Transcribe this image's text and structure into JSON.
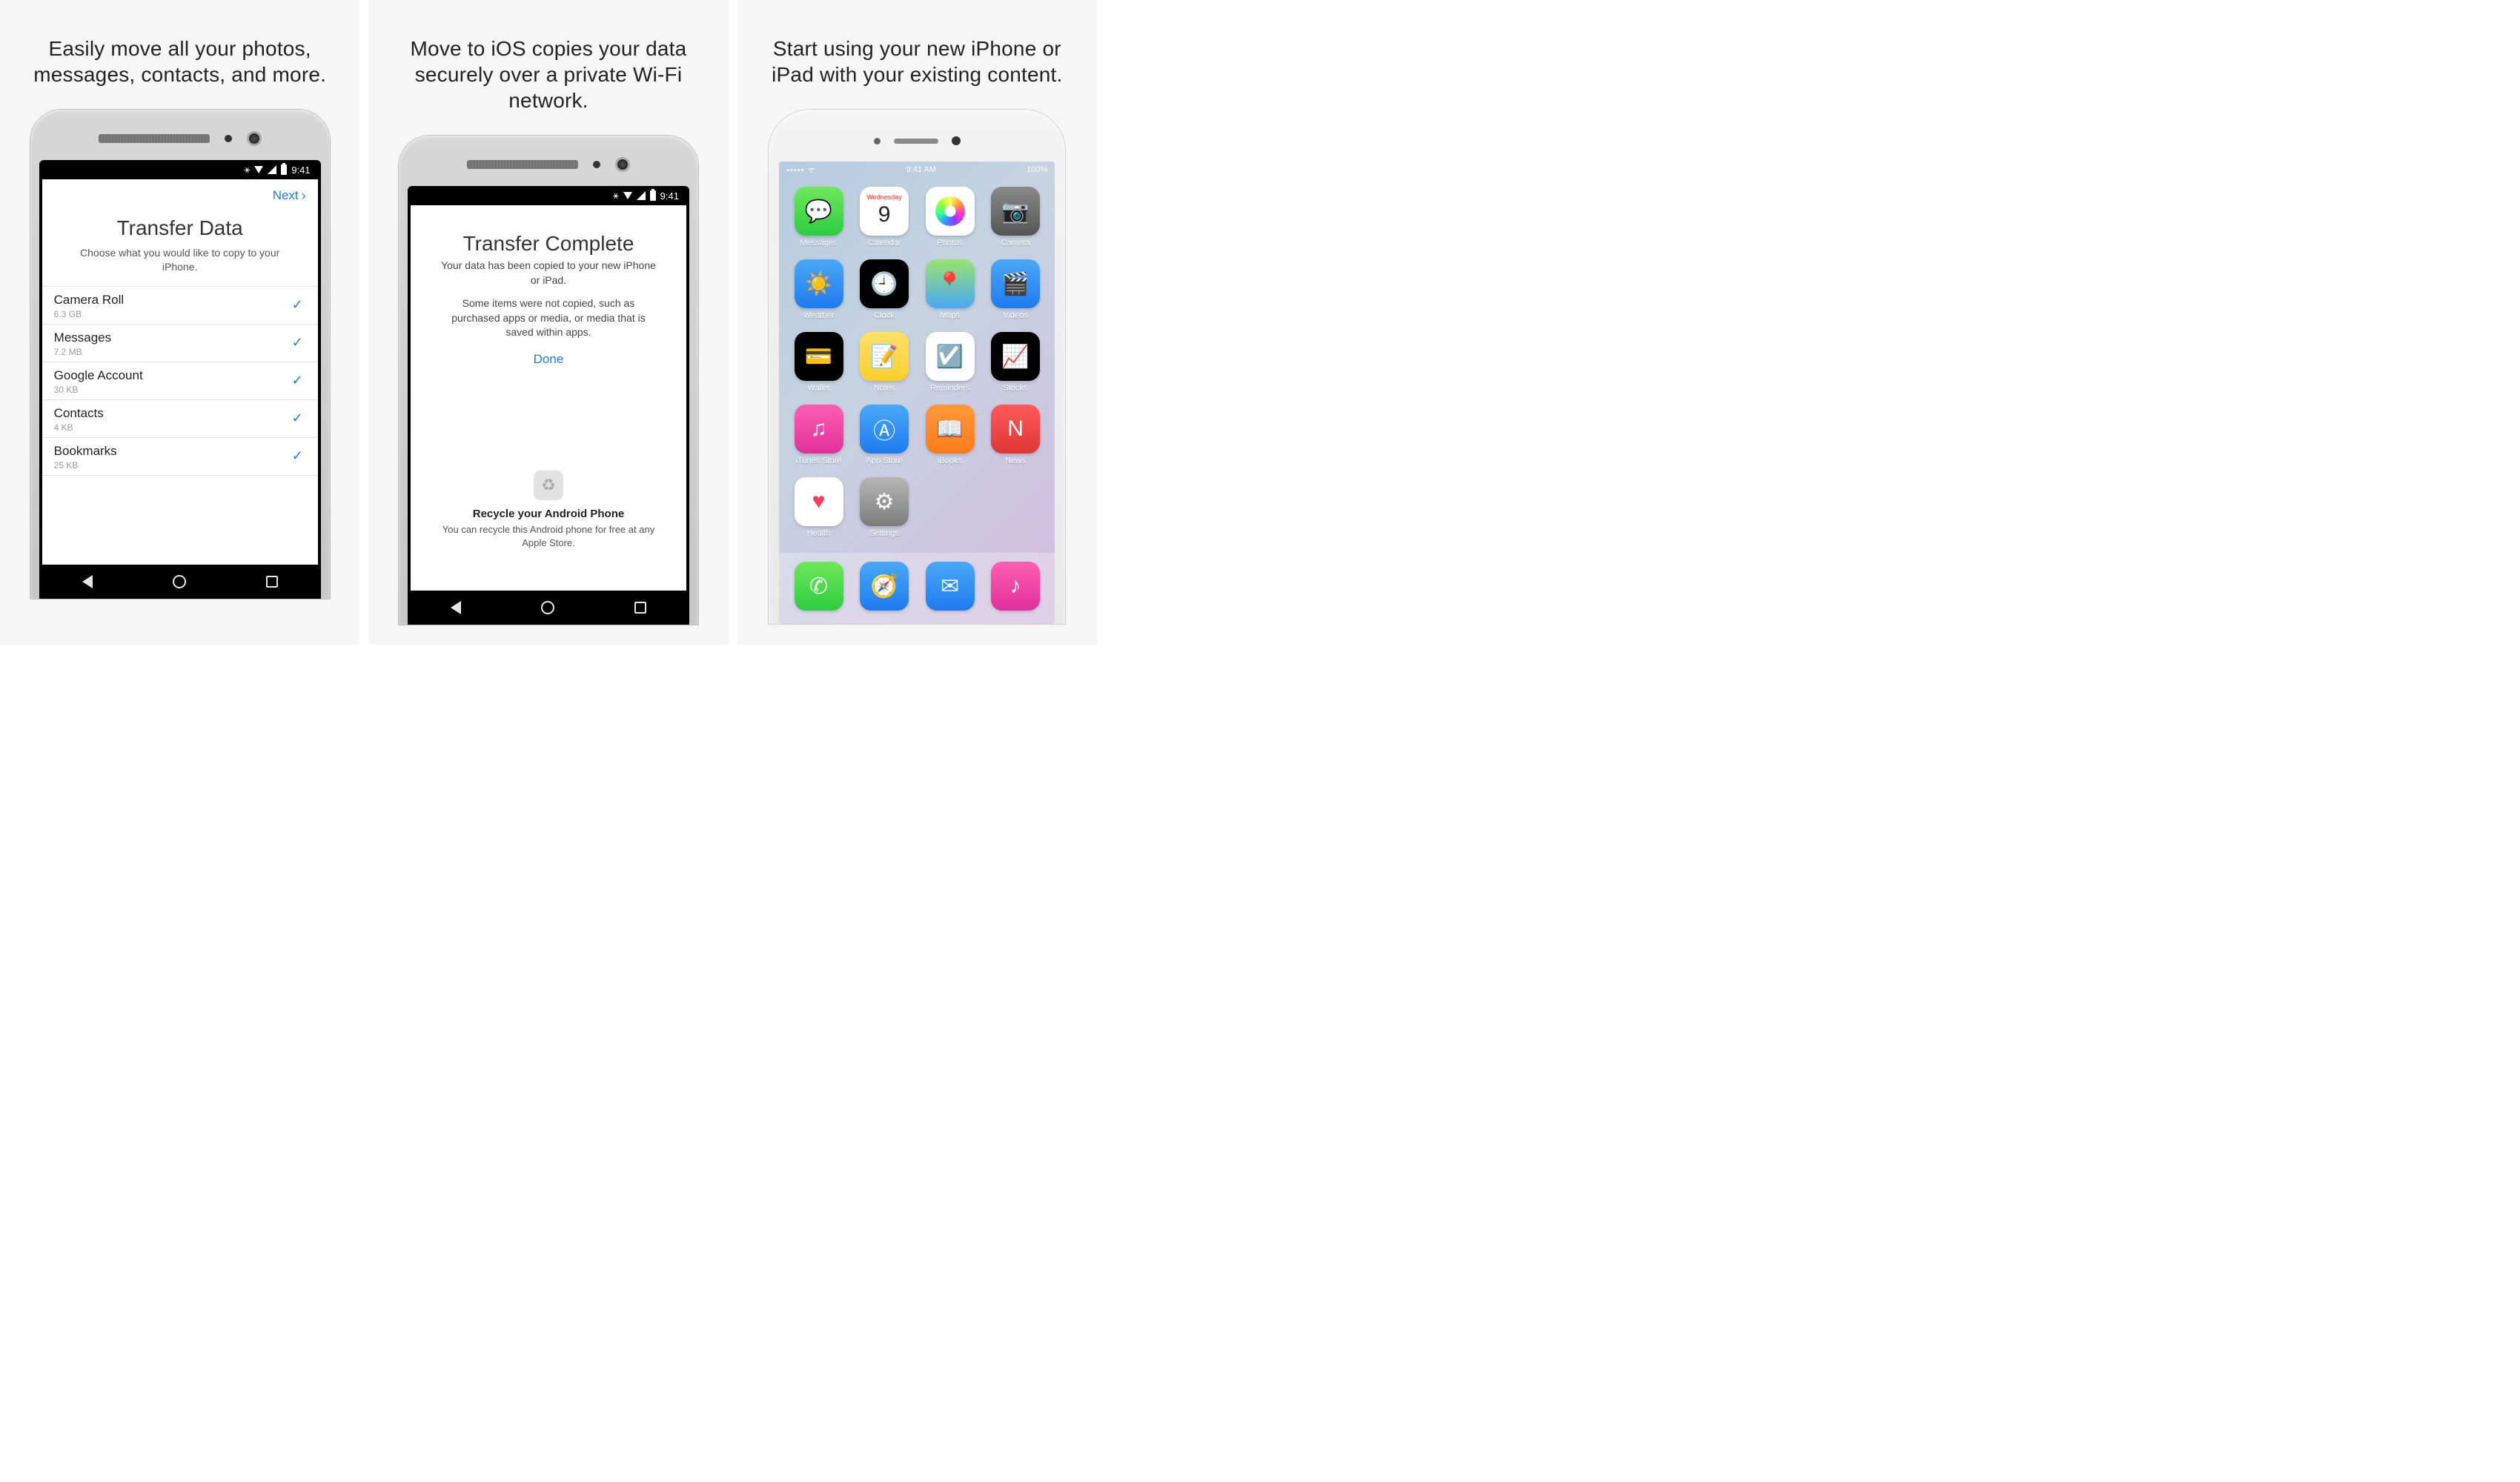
{
  "panels": [
    {
      "headline": "Easily move all your photos, messages, contacts, and more."
    },
    {
      "headline": "Move to iOS copies your data securely over a private Wi-Fi network."
    },
    {
      "headline": "Start using your new iPhone or iPad with your existing content."
    }
  ],
  "android_status": {
    "time": "9:41"
  },
  "screen1": {
    "next": "Next",
    "title": "Transfer Data",
    "subtitle": "Choose what you would like to copy to your iPhone.",
    "items": [
      {
        "label": "Camera Roll",
        "size": "6.3 GB"
      },
      {
        "label": "Messages",
        "size": "7.2 MB"
      },
      {
        "label": "Google Account",
        "size": "30 KB"
      },
      {
        "label": "Contacts",
        "size": "4 KB"
      },
      {
        "label": "Bookmarks",
        "size": "25 KB"
      }
    ]
  },
  "screen2": {
    "title": "Transfer Complete",
    "line1": "Your data has been copied to your new iPhone or iPad.",
    "line2": "Some items were not copied, such as purchased apps or media, or media that is saved within apps.",
    "done": "Done",
    "recycle_title": "Recycle your Android Phone",
    "recycle_text": "You can recycle this Android phone for free at any Apple Store."
  },
  "iphone_status": {
    "time": "9:41 AM",
    "battery": "100%"
  },
  "iphone_calendar": {
    "weekday": "Wednesday",
    "day": "9"
  },
  "iphone_apps_grid": [
    {
      "label": "Messages",
      "glyph": "💬",
      "bg": "bg-green"
    },
    {
      "label": "Calendar",
      "glyph": "",
      "bg": "bg-cal"
    },
    {
      "label": "Photos",
      "glyph": "",
      "bg": "bg-photos"
    },
    {
      "label": "Camera",
      "glyph": "📷",
      "bg": "bg-grey"
    },
    {
      "label": "Weather",
      "glyph": "☀️",
      "bg": "bg-blue"
    },
    {
      "label": "Clock",
      "glyph": "🕘",
      "bg": "bg-black"
    },
    {
      "label": "Maps",
      "glyph": "📍",
      "bg": "bg-maps"
    },
    {
      "label": "Videos",
      "glyph": "🎬",
      "bg": "bg-blue"
    },
    {
      "label": "Wallet",
      "glyph": "💳",
      "bg": "bg-black"
    },
    {
      "label": "Notes",
      "glyph": "📝",
      "bg": "bg-yellow"
    },
    {
      "label": "Reminders",
      "glyph": "☑️",
      "bg": "bg-white"
    },
    {
      "label": "Stocks",
      "glyph": "📈",
      "bg": "bg-black"
    },
    {
      "label": "iTunes Store",
      "glyph": "♫",
      "bg": "bg-pink"
    },
    {
      "label": "App Store",
      "glyph": "Ⓐ",
      "bg": "bg-blue"
    },
    {
      "label": "iBooks",
      "glyph": "📖",
      "bg": "bg-orange"
    },
    {
      "label": "News",
      "glyph": "N",
      "bg": "bg-red"
    },
    {
      "label": "Health",
      "glyph": "♥",
      "bg": "bg-health"
    },
    {
      "label": "Settings",
      "glyph": "⚙",
      "bg": "bg-settings"
    }
  ],
  "iphone_dock": [
    {
      "label": "Phone",
      "glyph": "✆",
      "bg": "bg-green"
    },
    {
      "label": "Safari",
      "glyph": "🧭",
      "bg": "bg-blue"
    },
    {
      "label": "Mail",
      "glyph": "✉",
      "bg": "bg-blue"
    },
    {
      "label": "Music",
      "glyph": "♪",
      "bg": "bg-pink"
    }
  ]
}
